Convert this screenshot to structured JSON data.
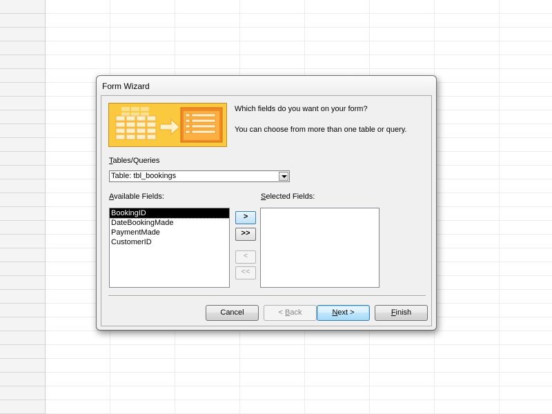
{
  "dialog": {
    "title": "Form Wizard",
    "question": "Which fields do you want on your form?",
    "hint": "You can choose from more than one table or query.",
    "tables_queries": {
      "label": "Tables/Queries",
      "mnemonic": "T",
      "label_rest": "ables/Queries",
      "value": "Table: tbl_bookings"
    },
    "available_fields": {
      "label": "Available Fields:",
      "mnemonic": "A",
      "label_rest": "vailable Fields:",
      "items": [
        "BookingID",
        "DateBookingMade",
        "PaymentMade",
        "CustomerID"
      ],
      "selected_item": "BookingID"
    },
    "selected_fields": {
      "label": "Selected Fields:",
      "mnemonic": "S",
      "label_rest": "elected Fields:",
      "items": []
    },
    "move_buttons": {
      "add": ">",
      "add_all": ">>",
      "remove": "<",
      "remove_all": "<<"
    },
    "buttons": {
      "cancel": "Cancel",
      "back_prefix": "< ",
      "back_mnemonic": "B",
      "back_rest": "ack",
      "next_mnemonic": "N",
      "next_rest": "ext >",
      "finish_mnemonic": "F",
      "finish_rest": "inish"
    }
  },
  "colors": {
    "banner_fill": "#f9c23a",
    "banner_accent": "#f07a1a",
    "selection": "#000000",
    "default_button_border": "#3c7fb1"
  },
  "icons": {
    "banner": "table-to-form-illustration",
    "dropdown": "chevron-down-icon"
  }
}
